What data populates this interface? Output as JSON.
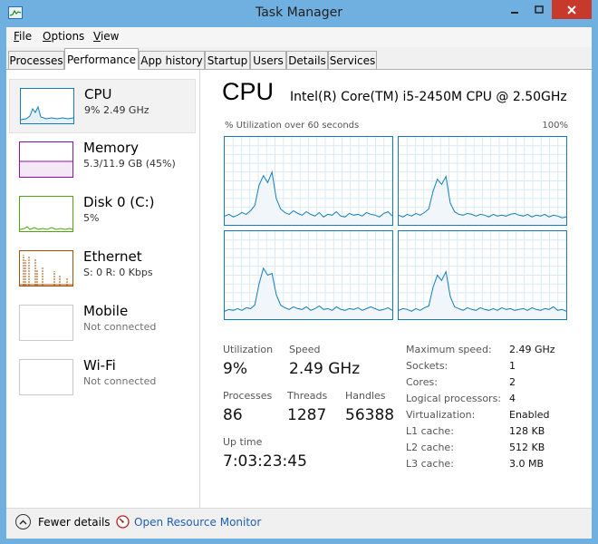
{
  "window": {
    "title": "Task Manager"
  },
  "menu": {
    "file": "ile",
    "file_key": "F",
    "options": "ptions",
    "options_key": "O",
    "view": "iew",
    "view_key": "V"
  },
  "tabs": [
    {
      "label": "Processes"
    },
    {
      "label": "Performance"
    },
    {
      "label": "App history"
    },
    {
      "label": "Startup"
    },
    {
      "label": "Users"
    },
    {
      "label": "Details"
    },
    {
      "label": "Services"
    }
  ],
  "sidebar": [
    {
      "name": "CPU",
      "sub": "9% 2.49 GHz",
      "color": "#117dbb"
    },
    {
      "name": "Memory",
      "sub": "5.3/11.9 GB (45%)",
      "color": "#8b12ae"
    },
    {
      "name": "Disk 0 (C:)",
      "sub": "5%",
      "color": "#4da60c"
    },
    {
      "name": "Ethernet",
      "sub": "S: 0 R: 0 Kbps",
      "color": "#a74f01"
    },
    {
      "name": "Mobile",
      "sub": "Not connected"
    },
    {
      "name": "Wi-Fi",
      "sub": "Not connected"
    }
  ],
  "cpu": {
    "title": "CPU",
    "model": "Intel(R) Core(TM) i5-2450M CPU @ 2.50GHz",
    "graph_label": "% Utilization over 60 seconds",
    "graph_max": "100%",
    "utilization_label": "Utilization",
    "utilization": "9%",
    "speed_label": "Speed",
    "speed": "2.49 GHz",
    "processes_label": "Processes",
    "processes": "86",
    "threads_label": "Threads",
    "threads": "1287",
    "handles_label": "Handles",
    "handles": "56388",
    "uptime_label": "Up time",
    "uptime": "7:03:23:45",
    "properties": [
      {
        "label": "Maximum speed:",
        "value": "2.49 GHz"
      },
      {
        "label": "Sockets:",
        "value": "1"
      },
      {
        "label": "Cores:",
        "value": "2"
      },
      {
        "label": "Logical processors:",
        "value": "4"
      },
      {
        "label": "Virtualization:",
        "value": "Enabled"
      },
      {
        "label": "L1 cache:",
        "value": "128 KB"
      },
      {
        "label": "L2 cache:",
        "value": "512 KB"
      },
      {
        "label": "L3 cache:",
        "value": "3.0 MB"
      }
    ],
    "graph_color": "#117dbb",
    "graph_fill": "#f1f6fa",
    "core_series": [
      [
        10,
        12,
        9,
        11,
        14,
        12,
        16,
        22,
        45,
        56,
        48,
        60,
        30,
        18,
        14,
        12,
        16,
        13,
        11,
        15,
        12,
        10,
        14,
        9,
        12,
        11,
        15,
        10,
        9,
        13,
        11,
        12,
        10,
        14,
        12,
        11,
        9,
        13,
        15,
        10
      ],
      [
        11,
        9,
        12,
        10,
        13,
        11,
        14,
        18,
        38,
        52,
        46,
        55,
        25,
        15,
        12,
        11,
        13,
        12,
        10,
        12,
        11,
        9,
        12,
        10,
        11,
        10,
        12,
        13,
        11,
        10,
        12,
        9,
        11,
        10,
        12,
        9,
        11,
        10,
        8,
        9
      ],
      [
        9,
        11,
        10,
        12,
        10,
        13,
        12,
        16,
        40,
        58,
        50,
        52,
        28,
        16,
        13,
        11,
        14,
        12,
        11,
        14,
        10,
        12,
        15,
        11,
        12,
        10,
        14,
        11,
        10,
        12,
        11,
        13,
        10,
        12,
        14,
        12,
        10,
        11,
        13,
        10
      ],
      [
        10,
        12,
        11,
        9,
        12,
        10,
        13,
        15,
        36,
        50,
        44,
        54,
        26,
        14,
        12,
        10,
        13,
        11,
        10,
        13,
        11,
        10,
        12,
        10,
        13,
        11,
        12,
        10,
        11,
        12,
        10,
        13,
        11,
        10,
        12,
        11,
        14,
        10,
        11,
        9
      ]
    ]
  },
  "footer": {
    "fewer_details": "Fewer details",
    "fewer_key": "d",
    "resource_monitor": "Open Resource Monitor"
  }
}
